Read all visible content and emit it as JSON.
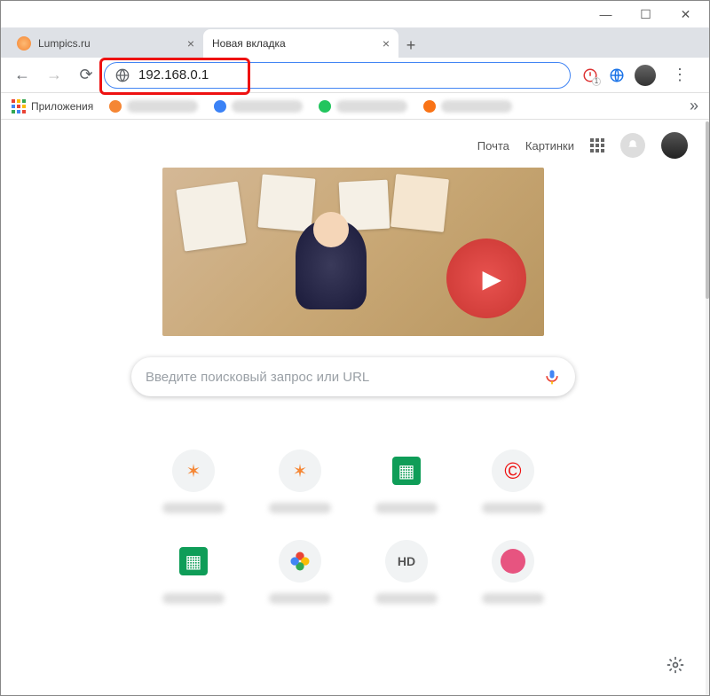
{
  "window_controls": {
    "minimize": "—",
    "maximize": "☐",
    "close": "✕"
  },
  "tabs": [
    {
      "label": "Lumpics.ru",
      "favicon_color": "#f58634",
      "active": false
    },
    {
      "label": "Новая вкладка",
      "favicon_color": "",
      "active": true
    }
  ],
  "newtab_symbol": "+",
  "nav": {
    "back": "←",
    "forward": "→",
    "reload": "⟳"
  },
  "address": {
    "value": "192.168.0.1",
    "info_icon": "ⓘ"
  },
  "extensions": {
    "badge": "1"
  },
  "menu_glyph": "⋮",
  "bookmarks": {
    "apps_label": "Приложения",
    "more": "»",
    "items": [
      {
        "dot": "#f58634"
      },
      {
        "dot": "#3b82f6"
      },
      {
        "dot": "#22c55e"
      },
      {
        "dot": "#f97316"
      }
    ]
  },
  "content_header": {
    "mail": "Почта",
    "images": "Картинки"
  },
  "search": {
    "placeholder": "Введите поисковый запрос или URL"
  },
  "shortcuts_row1": [
    {
      "glyph": "✶",
      "color": "#f58634"
    },
    {
      "glyph": "✶",
      "color": "#f58634"
    },
    {
      "glyph": "▦",
      "color": "#0f9d58"
    },
    {
      "glyph": "©",
      "color": "#e11"
    }
  ],
  "shortcuts_row2": [
    {
      "glyph": "▦",
      "color": "#0f9d58"
    },
    {
      "glyph": "✦",
      "color": "#4285f4"
    },
    {
      "glyph": "HD",
      "color": "#555"
    },
    {
      "glyph": "●",
      "color": "#e75480"
    }
  ]
}
